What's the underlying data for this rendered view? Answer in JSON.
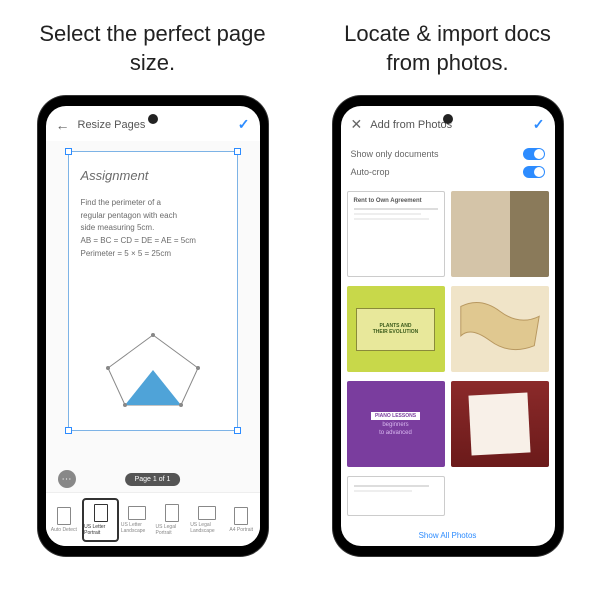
{
  "captions": {
    "left": "Select the perfect page size.",
    "right": "Locate & import docs from photos."
  },
  "left": {
    "header": {
      "title": "Resize Pages"
    },
    "doc": {
      "title": "Assignment",
      "line1": "Find the perimeter of a",
      "line2": "regular pentagon with each",
      "line3": "side measuring 5cm.",
      "line4": "AB = BC = CD = DE = AE = 5cm",
      "line5": "Perimeter = 5 × 5 = 25cm"
    },
    "pagebadge": "Page 1 of 1",
    "sizes": [
      {
        "label": "Auto Detect"
      },
      {
        "label": "US Letter Portrait"
      },
      {
        "label": "US Letter Landscape"
      },
      {
        "label": "US Legal Portrait"
      },
      {
        "label": "US Legal Landscape"
      },
      {
        "label": "A4 Portrait"
      }
    ]
  },
  "right": {
    "header": {
      "title": "Add from Photos"
    },
    "toggles": {
      "only_docs": "Show only documents",
      "autocrop": "Auto-crop"
    },
    "thumbs": {
      "doc1": "Rent to Own Agreement",
      "plants_l1": "PLANTS AND",
      "plants_l2": "THEIR EVOLUTION",
      "piano": "PIANO LESSONS",
      "piano_sub1": "beginners",
      "piano_sub2": "to advanced"
    },
    "showall": "Show All Photos"
  }
}
